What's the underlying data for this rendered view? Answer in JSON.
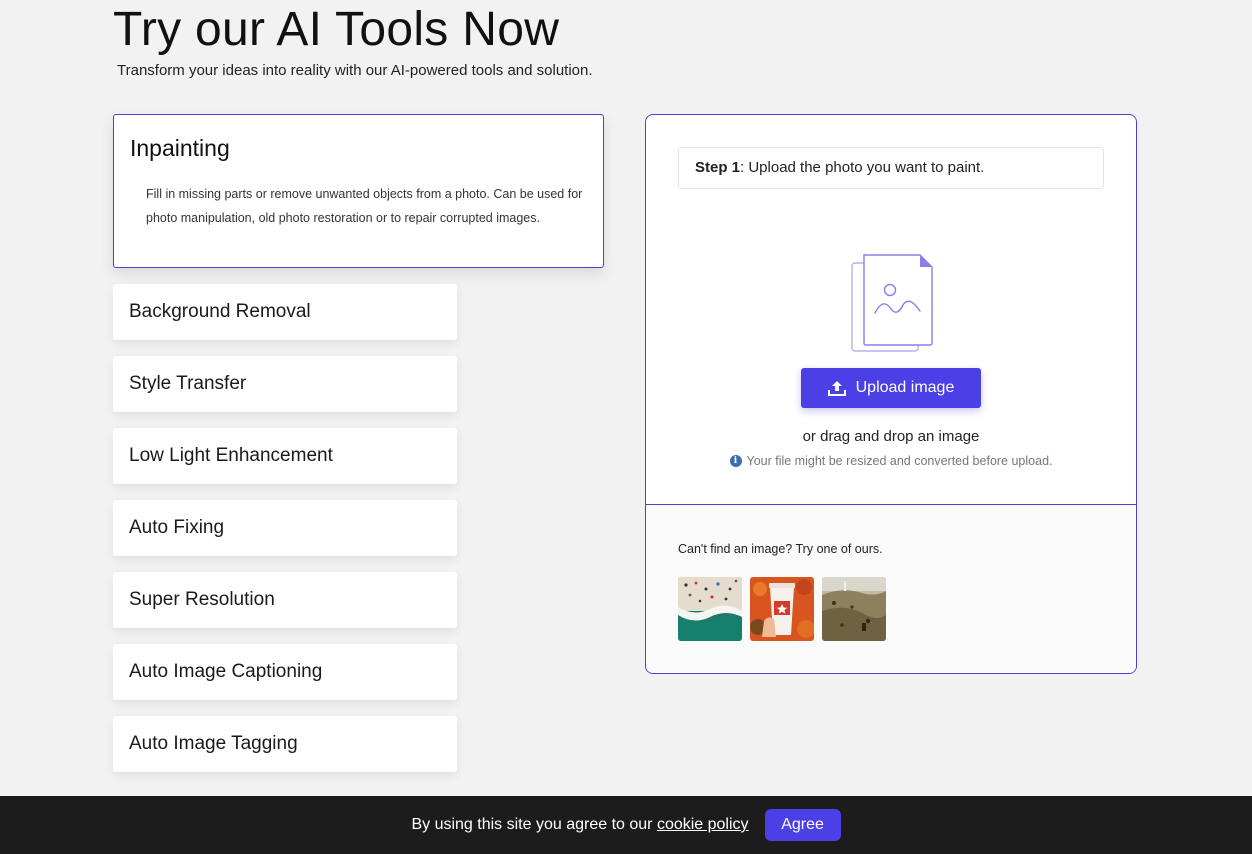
{
  "hero": {
    "title": "Try our AI Tools Now",
    "subtitle": "Transform your ideas into reality with our AI-powered tools and solution."
  },
  "tools": {
    "active": {
      "title": "Inpainting",
      "description": "Fill in missing parts or remove unwanted objects from a photo. Can be used for photo manipulation, old photo restoration or to repair corrupted images."
    },
    "items": [
      {
        "label": "Background Removal"
      },
      {
        "label": "Style Transfer"
      },
      {
        "label": "Low Light Enhancement"
      },
      {
        "label": "Auto Fixing"
      },
      {
        "label": "Super Resolution"
      },
      {
        "label": "Auto Image Captioning"
      },
      {
        "label": "Auto Image Tagging"
      }
    ]
  },
  "upload": {
    "step_label": "Step 1",
    "step_text": ": Upload the photo you want to paint.",
    "button_label": "Upload image",
    "drag_text": "or drag and drop an image",
    "note": "Your file might be resized and converted before upload.",
    "samples_label": "Can't find an image? Try one of ours."
  },
  "cookie": {
    "text": "By using this site you agree to our",
    "link": "cookie policy",
    "agree_label": "Agree"
  },
  "colors": {
    "accent": "#4b3fe6",
    "border_accent": "#4b3fd6",
    "background": "#f2f2f2",
    "cookie_bar": "#1c1c1c"
  },
  "icons": {
    "upload_button": "upload-icon",
    "illustration": "image-file-icon",
    "note": "info-icon"
  }
}
